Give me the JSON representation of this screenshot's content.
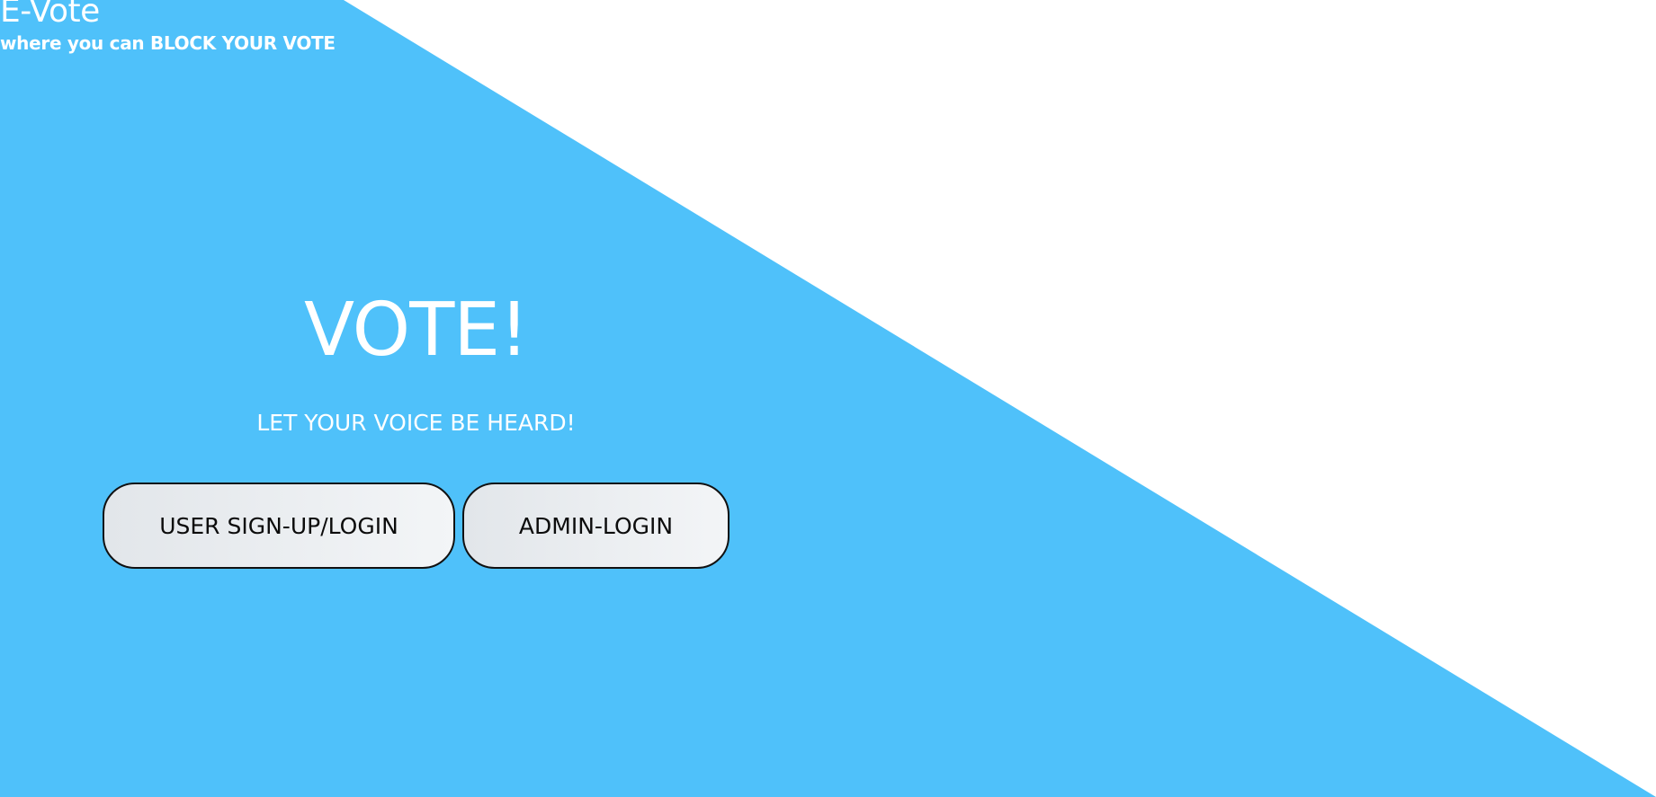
{
  "brand": {
    "title": "E-Vote",
    "tagline": "where you can BLOCK YOUR VOTE"
  },
  "hero": {
    "title": "VOTE!",
    "subtitle": "LET YOUR VOICE BE HEARD!"
  },
  "buttons": {
    "user_label": "USER SIGN-UP/LOGIN",
    "admin_label": "ADMIN-LOGIN"
  },
  "colors": {
    "accent": "#4fc1fa",
    "background": "#ffffff",
    "text_light": "#ffffff",
    "button_text": "#0c0c0c"
  }
}
